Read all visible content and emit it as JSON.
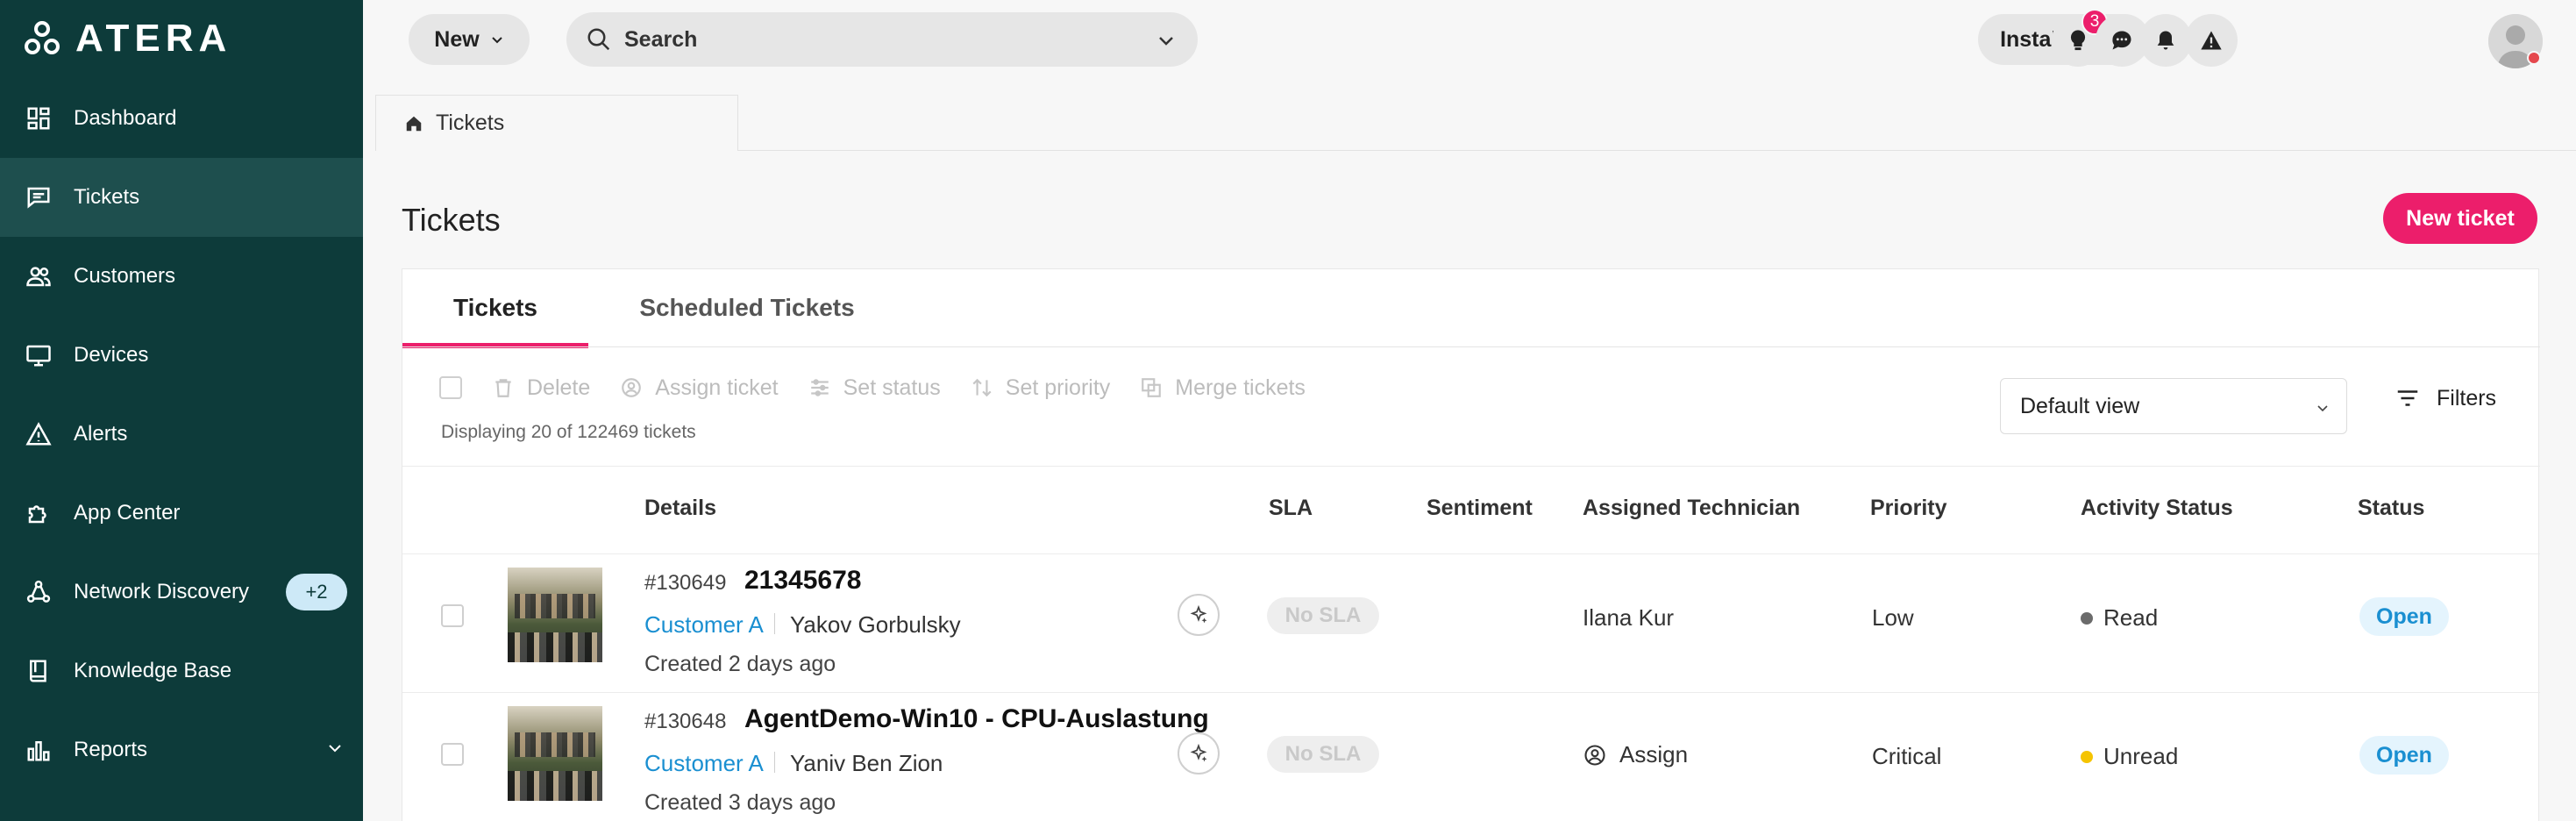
{
  "brand": {
    "name": "ATERA"
  },
  "sidebar": {
    "items": [
      {
        "label": "Dashboard",
        "icon": "dashboard-icon"
      },
      {
        "label": "Tickets",
        "icon": "tickets-icon",
        "active": true
      },
      {
        "label": "Customers",
        "icon": "customers-icon"
      },
      {
        "label": "Devices",
        "icon": "devices-icon"
      },
      {
        "label": "Alerts",
        "icon": "alerts-icon"
      },
      {
        "label": "App Center",
        "icon": "app-center-icon"
      },
      {
        "label": "Network Discovery",
        "icon": "network-discovery-icon",
        "badge": "+2"
      },
      {
        "label": "Knowledge Base",
        "icon": "knowledge-base-icon"
      },
      {
        "label": "Reports",
        "icon": "reports-icon",
        "expandable": true
      }
    ]
  },
  "topbar": {
    "new_label": "New",
    "search_placeholder": "Search",
    "install_label": "Install agent",
    "notification_count": "3"
  },
  "breadcrumb": {
    "label": "Tickets"
  },
  "page": {
    "title": "Tickets",
    "new_ticket_label": "New ticket"
  },
  "tabs": [
    {
      "label": "Tickets",
      "active": true
    },
    {
      "label": "Scheduled Tickets"
    }
  ],
  "toolbar": {
    "delete": "Delete",
    "assign": "Assign ticket",
    "set_status": "Set status",
    "set_priority": "Set priority",
    "merge": "Merge tickets",
    "displaying": "Displaying 20 of 122469 tickets",
    "view": "Default view",
    "filters": "Filters"
  },
  "table": {
    "columns": [
      "Details",
      "SLA",
      "Sentiment",
      "Assigned Technician",
      "Priority",
      "Activity Status",
      "Status"
    ],
    "rows": [
      {
        "id": "#130649",
        "title": "21345678",
        "customer": "Customer A",
        "contact": "Yakov Gorbulsky",
        "created": "Created 2 days ago",
        "sla": "No SLA",
        "technician": "Ilana Kur",
        "priority": "Low",
        "activity": "Read",
        "activity_color": "#6b6b6b",
        "status": "Open"
      },
      {
        "id": "#130648",
        "title": "AgentDemo-Win10 - CPU-Auslastung",
        "customer": "Customer A",
        "contact": "Yaniv Ben Zion",
        "created": "Created 3 days ago",
        "sla": "No SLA",
        "technician": "Assign",
        "priority": "Critical",
        "activity": "Unread",
        "activity_color": "#f5c400",
        "status": "Open"
      }
    ]
  },
  "colors": {
    "sidebar": "#0d3b3a",
    "accent": "#ec1e6b",
    "link": "#1a8fd1"
  }
}
